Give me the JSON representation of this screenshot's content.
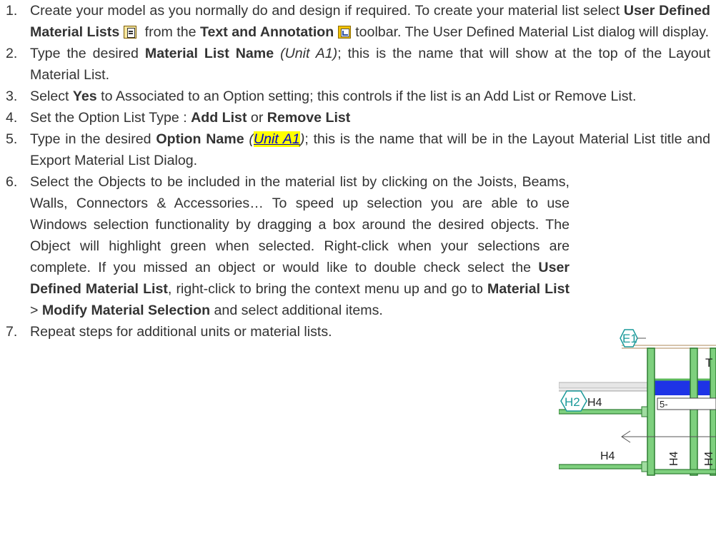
{
  "steps": [
    {
      "num": "1.",
      "parts": [
        {
          "t": "Create your model as you normally do and design if required. To create your material list select "
        },
        {
          "t": "User Defined Material Lists",
          "c": "b"
        },
        {
          "icon": "user-defined-material-lists-icon"
        },
        {
          "t": " from the "
        },
        {
          "t": "Text and Annotation",
          "c": "b"
        },
        {
          "icon": "text-and-annotation-icon"
        },
        {
          "t": "toolbar. The User Defined Material List dialog will display."
        }
      ]
    },
    {
      "num": "2.",
      "parts": [
        {
          "t": "Type the desired "
        },
        {
          "t": "Material List Name",
          "c": "b"
        },
        {
          "t": " "
        },
        {
          "t": "(Unit A1)",
          "c": "i"
        },
        {
          "t": "; this is the name that will show at the top of the Layout Material List."
        }
      ]
    },
    {
      "num": "3.",
      "parts": [
        {
          "t": "Select "
        },
        {
          "t": "Yes",
          "c": "b"
        },
        {
          "t": " to Associated to an Option setting; this controls if the list is an Add List or Remove List."
        }
      ]
    },
    {
      "num": "4.",
      "parts": [
        {
          "t": "Set the Option List Type : "
        },
        {
          "t": "Add List",
          "c": "b"
        },
        {
          "t": " or "
        },
        {
          "t": "Remove List",
          "c": "b"
        }
      ]
    },
    {
      "num": "5.",
      "parts": [
        {
          "t": "Type in the desired "
        },
        {
          "t": "Option Name",
          "c": "b"
        },
        {
          "t": " "
        },
        {
          "t": "(",
          "c": "i"
        },
        {
          "t": "Unit A1",
          "c": "hl"
        },
        {
          "t": ")",
          "c": "i"
        },
        {
          "t": "; this is the name that will be in the Layout Material List title and Export Material List Dialog."
        }
      ]
    },
    {
      "num": "6.",
      "narrow": true,
      "parts": [
        {
          "t": "Select the Objects to be included in the material list by clicking on the Joists, Beams, Walls, Connectors & Accessories… To speed up selection you are able to use Windows selection functionality by dragging a box around the desired objects. The Object will highlight green when selected. Right-click when your selections are complete. If you missed an object or would like to double check select the "
        },
        {
          "t": "User Defined Material List",
          "c": "b"
        },
        {
          "t": ", right-click to bring the context menu up and go to "
        },
        {
          "t": "Material List",
          "c": "b"
        },
        {
          "t": " > "
        },
        {
          "t": "Modify Material Selection",
          "c": "b"
        },
        {
          "t": " and select additional items."
        }
      ]
    },
    {
      "num": "7.",
      "parts": [
        {
          "t": "Repeat steps for additional units or material lists."
        }
      ]
    }
  ],
  "figure": {
    "labels": {
      "e1": "E1",
      "h2": "H2",
      "h4_a": "H4",
      "h4_b": "H4",
      "h4_rot_a": "H4",
      "h4_rot_b": "H4",
      "t": "T",
      "box": "5-"
    },
    "colors": {
      "joist_green": "#5cb85c",
      "joist_dark": "#2e7d32",
      "beam_blue": "#1e33e6",
      "hex_teal": "#1a9a9a"
    }
  }
}
